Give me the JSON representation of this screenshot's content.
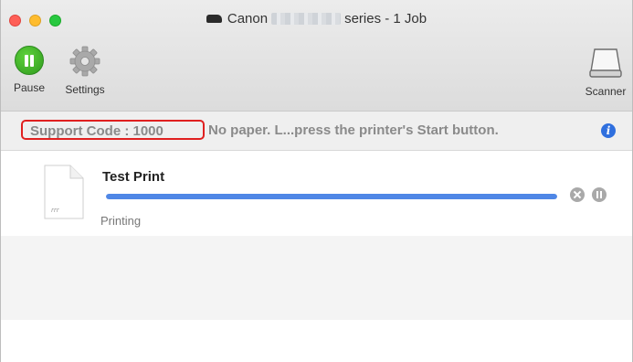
{
  "window": {
    "title_brand": "Canon",
    "title_suffix": "series - 1 Job"
  },
  "toolbar": {
    "pause_label": "Pause",
    "settings_label": "Settings",
    "scanner_label": "Scanner"
  },
  "status": {
    "support_code": "Support Code : 1000",
    "message": "No paper. L...press the printer's Start button.",
    "info_glyph": "i",
    "highlight_color": "#e02020"
  },
  "jobs": [
    {
      "name": "Test Print",
      "status": "Printing",
      "progress": 1.0,
      "icon": "document-icon"
    }
  ],
  "colors": {
    "progress": "#4f87e6",
    "pause_button": "#3db226",
    "info": "#2f6fde"
  }
}
